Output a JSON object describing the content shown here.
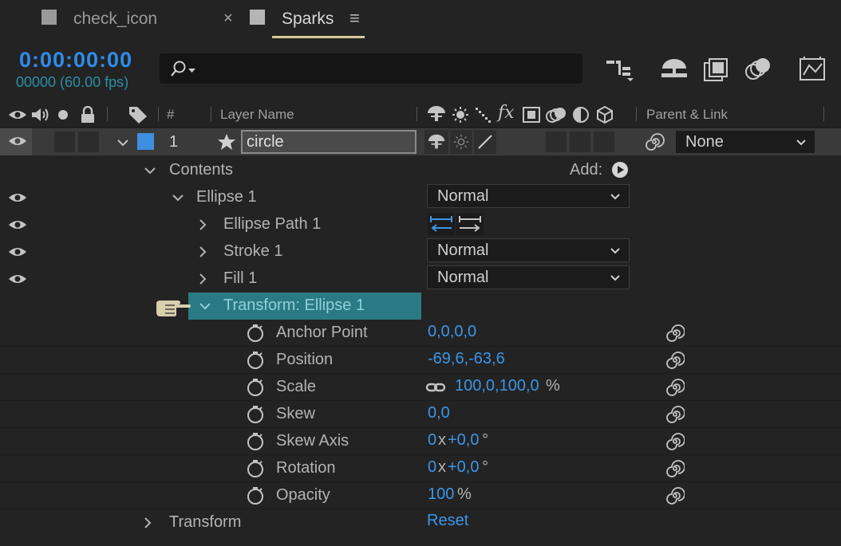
{
  "tabs": [
    {
      "label": "check_icon",
      "active": false
    },
    {
      "label": "Sparks",
      "active": true
    }
  ],
  "tab_close_glyph": "×",
  "tab_menu_glyph": "≡",
  "timecode": "0:00:00:00",
  "frame_info": "00000 (60.00 fps)",
  "search": {
    "placeholder": ""
  },
  "toolbar_icons": [
    "composition-mini-flowchart-icon",
    "draft-3d-icon",
    "frame-blending-icon",
    "motion-blur-icon",
    "graph-editor-icon"
  ],
  "columns": {
    "number": "#",
    "layer_name": "Layer Name",
    "parent_link": "Parent & Link"
  },
  "layer": {
    "number": "1",
    "name": "circle",
    "label_color": "#3d8fe0",
    "parent": "None"
  },
  "contents_label": "Contents",
  "add_label": "Add:",
  "ellipse_group": {
    "name": "Ellipse 1",
    "blend_mode": "Normal",
    "children": [
      {
        "name": "Ellipse Path 1"
      },
      {
        "name": "Stroke 1",
        "blend_mode": "Normal"
      },
      {
        "name": "Fill 1",
        "blend_mode": "Normal"
      }
    ],
    "transform_label": "Transform: Ellipse 1"
  },
  "properties": [
    {
      "name": "Anchor Point",
      "value": "0,0,0,0"
    },
    {
      "name": "Position",
      "value": "-69,6,-63,6"
    },
    {
      "name": "Scale",
      "value": "100,0,100,0",
      "suffix": "%"
    },
    {
      "name": "Skew",
      "value": "0,0"
    },
    {
      "name": "Skew Axis",
      "value": "0",
      "mid": "x",
      "value2": "+0,0",
      "suffix": "°"
    },
    {
      "name": "Rotation",
      "value": "0",
      "mid": "x",
      "value2": "+0,0",
      "suffix": "°"
    },
    {
      "name": "Opacity",
      "value": "100",
      "suffix": "%"
    }
  ],
  "transform_label": "Transform",
  "reset_label": "Reset",
  "colors": {
    "accent_blue": "#3a96e8",
    "selected_row": "#2a7a85",
    "tab_underline": "#d6c79a"
  }
}
